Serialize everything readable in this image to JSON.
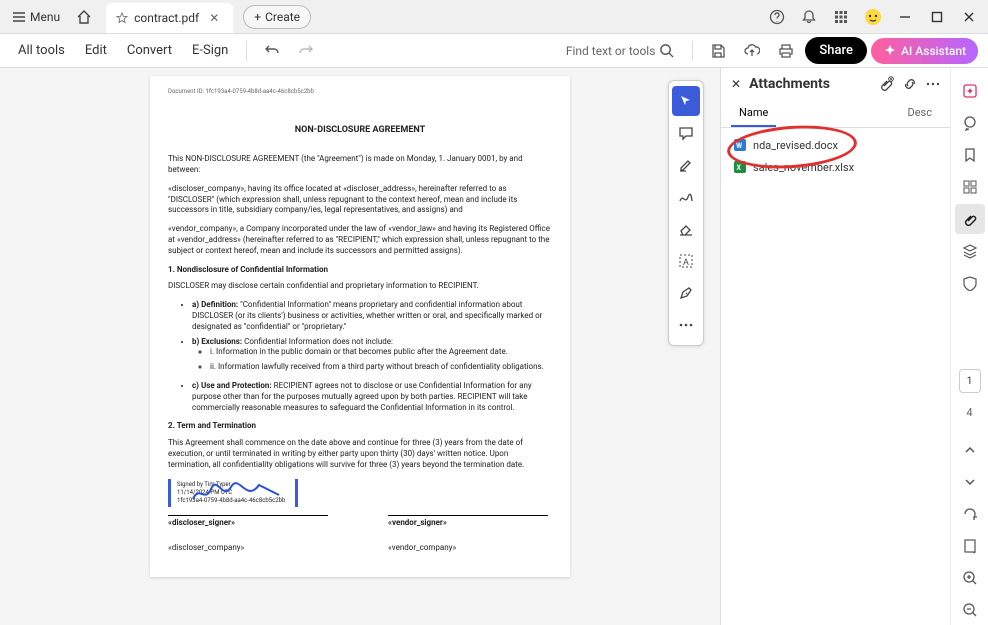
{
  "titlebar": {
    "menu_label": "Menu",
    "tab_title": "contract.pdf",
    "create_label": "Create"
  },
  "toolbar": {
    "all_tools": "All tools",
    "edit": "Edit",
    "convert": "Convert",
    "esign": "E-Sign",
    "search_placeholder": "Find text or tools",
    "share_label": "Share",
    "ai_label": "AI Assistant"
  },
  "document": {
    "doc_id": "Document ID: 1fc193a4-0759-4b8d-aa4c-46c8cb5c2bb",
    "title": "NON-DISCLOSURE AGREEMENT",
    "p1": "This NON-DISCLOSURE AGREEMENT (the \"Agreement\") is made on Monday, 1. January 0001, by and between:",
    "p2": "«discloser_company», having its office located at «discloser_address», hereinafter referred to as \"DISCLOSER\" (which expression shall, unless repugnant to the context hereof, mean and include its successors in title, subsidiary company/ies, legal representatives, and assigns) and",
    "p3": "«vendor_company», a Company incorporated under the law of «vendor_law» and having its Registered Office at «vendor_address» (hereinafter referred to as \"RECIPIENT,\" which expression shall, unless repugnant to the subject or context hereof, mean and include its successors and permitted assigns).",
    "sec1": "1. Nondisclosure of Confidential Information",
    "p4": "DISCLOSER may disclose certain confidential and proprietary information to RECIPIENT.",
    "li_a_label": "a) Definition:",
    "li_a": " \"Confidential Information\" means proprietary and confidential information about DISCLOSER (or its clients') business or activities, whether written or oral, and specifically marked or designated as \"confidential\" or \"proprietary.\"",
    "li_b_label": "b) Exclusions:",
    "li_b": " Confidential Information does not include:",
    "li_b1": "i. Information in the public domain or that becomes public after the Agreement date.",
    "li_b2": "ii. Information lawfully received from a third party without breach of confidentiality obligations.",
    "li_c_label": "c) Use and Protection:",
    "li_c": " RECIPIENT agrees not to disclose or use Confidential Information for any purpose other than for the purposes mutually agreed upon by both parties. RECIPIENT will take commercially reasonable measures to safeguard the Confidential Information in its control.",
    "sec2": "2. Term and Termination",
    "p5": "This Agreement shall commence on the date above and continue for three (3) years from the date of execution, or until terminated in writing by either party upon thirty (30) days' written notice. Upon termination, all confidentiality obligations will survive for three (3) years beyond the termination date.",
    "sig_name": "Signed by Tim Typer",
    "sig_date": "11/14/2024 PM UTC",
    "sig_hash": "1fc193a4-0759-4b8d-aa4c-46c8cb5c2bb",
    "discloser_signer": "«discloser_signer»",
    "vendor_signer": "«vendor_signer»",
    "discloser_company": "«discloser_company»",
    "vendor_company": "«vendor_company»"
  },
  "side": {
    "title": "Attachments",
    "tab_name": "Name",
    "tab_desc": "Desc",
    "files": [
      {
        "name": "nda_revised.docx",
        "type": "docx"
      },
      {
        "name": "sales_november.xlsx",
        "type": "xlsx"
      }
    ]
  },
  "rail": {
    "current_page": "1",
    "total_pages": "4"
  }
}
